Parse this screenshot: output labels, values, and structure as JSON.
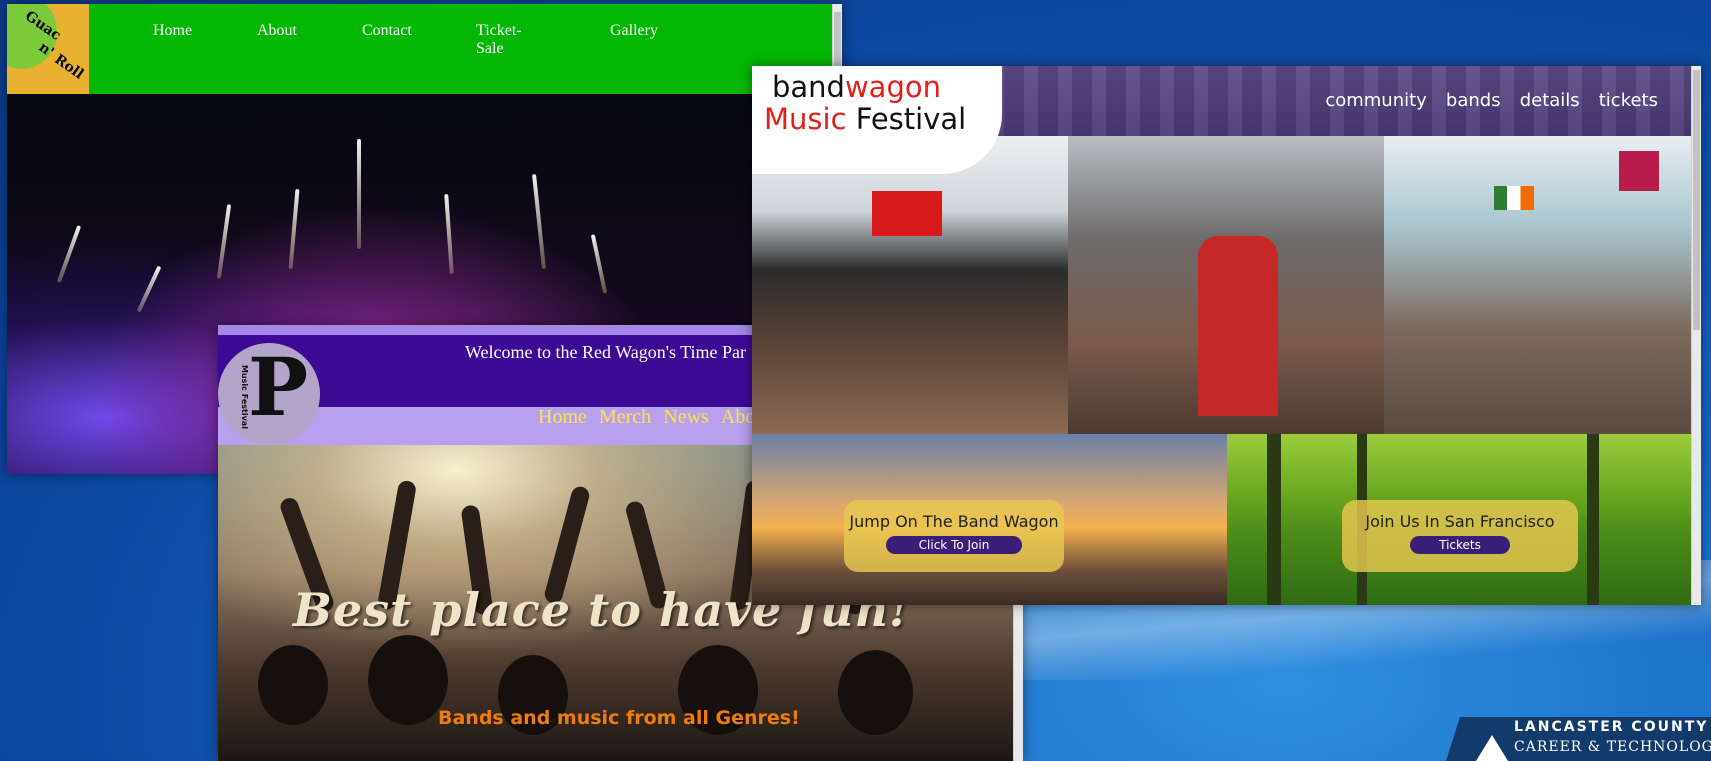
{
  "guac_window": {
    "logo": {
      "line1": "Guac",
      "line2": "n'",
      "line3": "Roll"
    },
    "nav": [
      "Home",
      "About",
      "Contact",
      "Ticket-Sale",
      "Gallery"
    ]
  },
  "redwagon_window": {
    "welcome": "Welcome to the Red Wagon's Time Par",
    "logo": {
      "letter": "P",
      "vertical_text": "Music Festival"
    },
    "nav": [
      "Home",
      "Merch",
      "News",
      "Abou"
    ],
    "headline": "Best place to have fun!",
    "subheadline": "Bands and music from all Genres!"
  },
  "bandwagon_window": {
    "logo": {
      "band": "band",
      "wagon": "wagon",
      "music": "Music",
      "festival": "Festival"
    },
    "nav": [
      "community",
      "bands",
      "details",
      "tickets"
    ],
    "cta_left": {
      "title": "Jump On The Band Wagon",
      "button": "Click To Join"
    },
    "cta_right": {
      "title": "Join Us In San Francisco",
      "button": "Tickets"
    }
  },
  "desktop": {
    "school_logo_line1": "LANCASTER COUNTY",
    "school_logo_line2": "CAREER & TECHNOLOGY C"
  },
  "colors": {
    "guac_header": "#04b704",
    "redwagon_purple": "#3d0a96",
    "redwagon_nav_text": "#ffe34a",
    "redwagon_sub": "#ee7d0b",
    "bandwagon_red": "#e0221b",
    "bandwagon_button": "#3b1e77",
    "desktop_blue": "#1565c0"
  }
}
